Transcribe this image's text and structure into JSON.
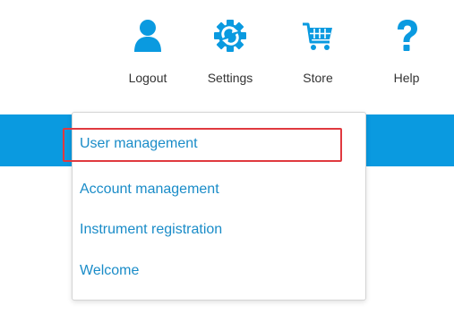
{
  "toolbar": {
    "items": [
      {
        "label": "Logout",
        "icon": "user-icon",
        "color": "#0a9ae0"
      },
      {
        "label": "Settings",
        "icon": "gear-icon",
        "color": "#0a9ae0"
      },
      {
        "label": "Store",
        "icon": "cart-icon",
        "color": "#0a9ae0"
      },
      {
        "label": "Help",
        "icon": "help-icon",
        "color": "#0a9ae0"
      }
    ]
  },
  "header_bar": {
    "color": "#0a9ae0"
  },
  "dropdown": {
    "items": [
      {
        "label": "User management",
        "highlighted": true
      },
      {
        "label": "Account management"
      },
      {
        "label": "Instrument registration"
      },
      {
        "label": "Welcome"
      }
    ],
    "text_color": "#1a8cc8",
    "highlight_color": "#e0393f"
  }
}
